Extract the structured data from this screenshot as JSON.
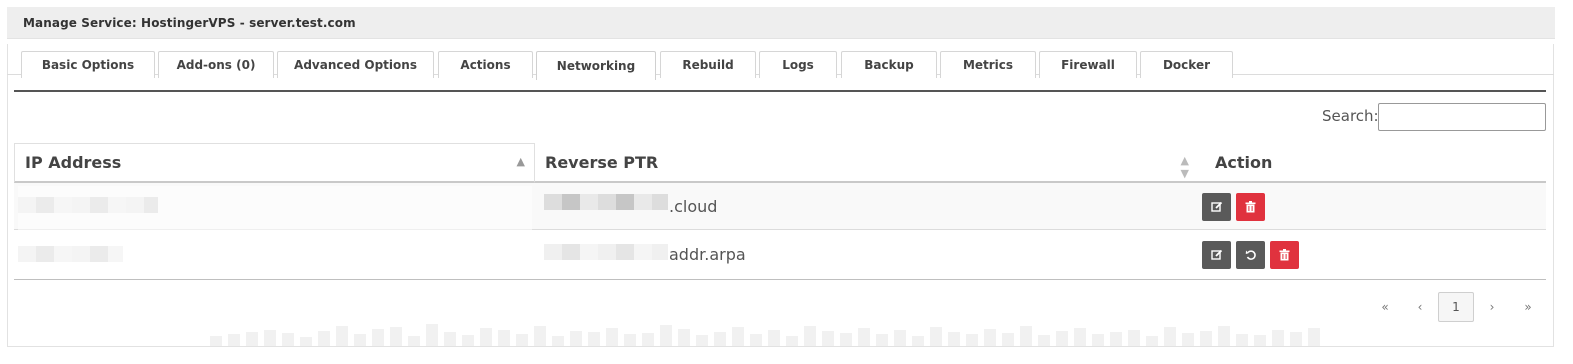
{
  "header": {
    "title": "Manage Service: HostingerVPS - server.test.com"
  },
  "tabs": [
    {
      "label": "Basic Options"
    },
    {
      "label": "Add-ons (0)"
    },
    {
      "label": "Advanced Options"
    },
    {
      "label": "Actions"
    },
    {
      "label": "Networking"
    },
    {
      "label": "Rebuild"
    },
    {
      "label": "Logs"
    },
    {
      "label": "Backup"
    },
    {
      "label": "Metrics"
    },
    {
      "label": "Firewall"
    },
    {
      "label": "Docker"
    }
  ],
  "active_tab": "Networking",
  "search": {
    "label": "Search:",
    "value": "",
    "placeholder": ""
  },
  "table": {
    "columns": [
      "IP Address",
      "Reverse PTR",
      "Action"
    ],
    "rows": [
      {
        "ip": "",
        "ptr_suffix": ".cloud",
        "actions": [
          "edit",
          "delete"
        ]
      },
      {
        "ip": "",
        "ptr_suffix": "addr.arpa",
        "actions": [
          "edit",
          "reset",
          "delete"
        ]
      }
    ]
  },
  "icons": {
    "sort": "sort-icon",
    "edit": "edit-icon",
    "delete": "trash-icon",
    "reset": "undo-icon"
  },
  "colors": {
    "danger": "#e0323e",
    "dark_button": "#5a5a5a",
    "header_bg": "#eeeeee"
  },
  "pagination": {
    "first": "«",
    "prev": "‹",
    "current": "1",
    "next": "›",
    "last": "»"
  }
}
